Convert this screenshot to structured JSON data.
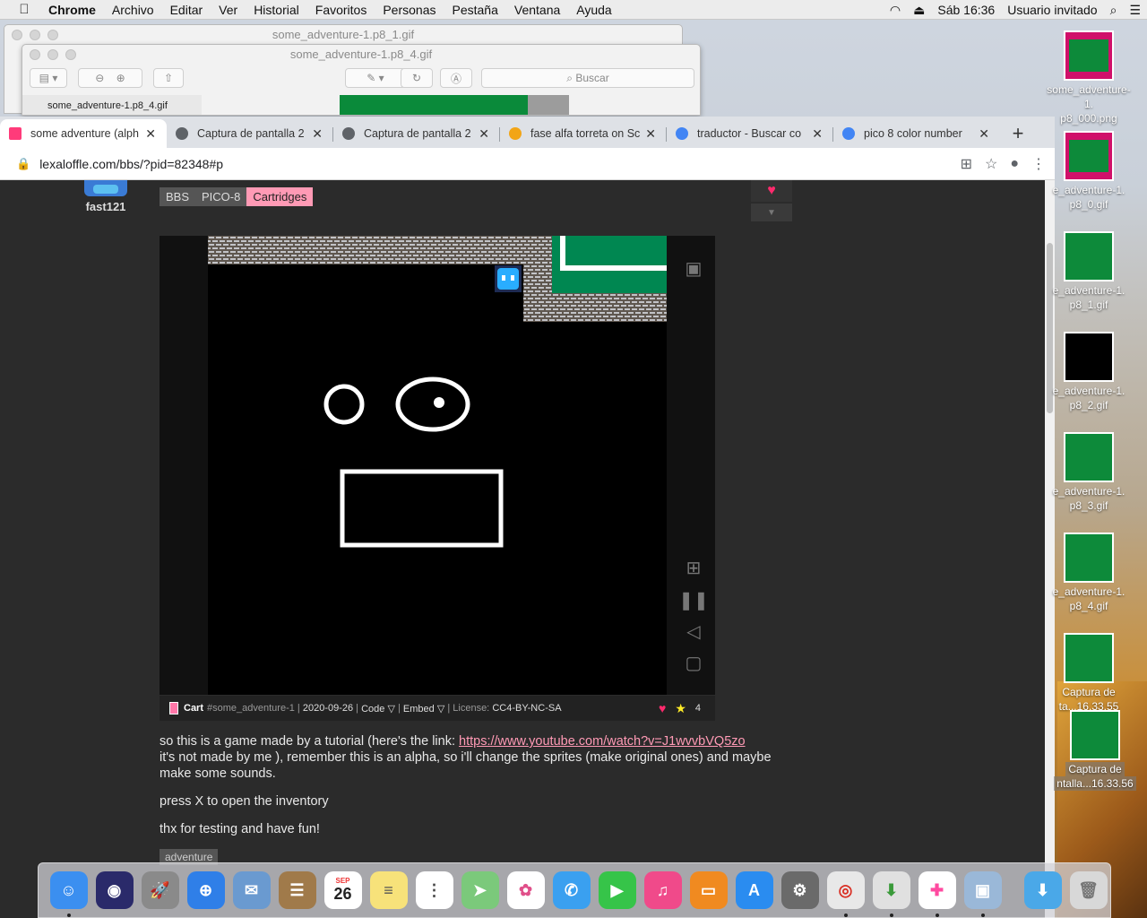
{
  "menubar": {
    "apple": "",
    "app_name": "Chrome",
    "items": [
      "Archivo",
      "Editar",
      "Ver",
      "Historial",
      "Favoritos",
      "Personas",
      "Pestaña",
      "Ventana",
      "Ayuda"
    ],
    "clock": "Sáb 16:36",
    "user": "Usuario invitado"
  },
  "preview_windows": {
    "back_title": "some_adventure-1.p8_1.gif",
    "front_title": "some_adventure-1.p8_4.gif",
    "search_placeholder": "Buscar",
    "sidebar_item": "some_adventure-1.p8_4.gif"
  },
  "tabs": [
    {
      "label": "some adventure (alph",
      "color": "#ff3b7a"
    },
    {
      "label": "Captura de pantalla 2",
      "color": "#5f6368"
    },
    {
      "label": "Captura de pantalla 2",
      "color": "#5f6368"
    },
    {
      "label": "fase alfa torreta on Sc",
      "color": "#f2a516"
    },
    {
      "label": "traductor - Buscar co",
      "color": "#4285f4"
    },
    {
      "label": "pico 8 color number",
      "color": "#4285f4"
    }
  ],
  "url": "lexaloffle.com/bbs/?pid=82348#p",
  "post": {
    "username": "fast121",
    "breadcrumbs": [
      "BBS",
      "PICO-8",
      "Cartridges"
    ],
    "cart_label": "Cart",
    "cart_id": "#some_adventure-1",
    "date": "2020-09-26",
    "code": "Code ▽",
    "embed": "Embed ▽",
    "license_label": "License:",
    "license": "CC4-BY-NC-SA",
    "stars": "4",
    "body_1a": "so this is a game made by a tutorial (here's the link: ",
    "link": "https://www.youtube.com/watch?v=J1wvvbVQ5zo",
    "body_1b": "it's not made by me ), remember this is an alpha, so i'll change the sprites (make original ones) and maybe make some sounds.",
    "body_2": "press X to open the inventory",
    "body_3": "thx for testing and have fun!",
    "tag": "adventure"
  },
  "desktop_icons": [
    {
      "line1": "some_adventure-1.",
      "line2": "p8_000.png"
    },
    {
      "line1": "e_adventure-1.",
      "line2": "p8_0.gif"
    },
    {
      "line1": "e_adventure-1.",
      "line2": "p8_1.gif"
    },
    {
      "line1": "e_adventure-1.",
      "line2": "p8_2.gif"
    },
    {
      "line1": "e_adventure-1.",
      "line2": "p8_3.gif"
    },
    {
      "line1": "e_adventure-1.",
      "line2": "p8_4.gif"
    },
    {
      "line1": "Captura de",
      "line2": "ta...16.33.55"
    },
    {
      "line1": "Captura de",
      "line2": "ntalla...16.33.56"
    }
  ],
  "dock_apps": [
    {
      "name": "finder",
      "color": "#3b8ff0",
      "glyph": "☺"
    },
    {
      "name": "siri",
      "color": "#2a2a6a",
      "glyph": "◉"
    },
    {
      "name": "launchpad",
      "color": "#8a8a8a",
      "glyph": "🚀"
    },
    {
      "name": "safari",
      "color": "#2f7fe8",
      "glyph": "⊕"
    },
    {
      "name": "mail",
      "color": "#6a9ad0",
      "glyph": "✉"
    },
    {
      "name": "contacts",
      "color": "#a07a4a",
      "glyph": "☰"
    },
    {
      "name": "calendar",
      "color": "#ffffff",
      "glyph": "26",
      "text": "#222",
      "cal_month": "SEP"
    },
    {
      "name": "notes",
      "color": "#f7e27a",
      "glyph": "≡",
      "text": "#555"
    },
    {
      "name": "reminders",
      "color": "#ffffff",
      "glyph": "⋮",
      "text": "#444"
    },
    {
      "name": "maps",
      "color": "#7bc97b",
      "glyph": "➤"
    },
    {
      "name": "photos",
      "color": "#ffffff",
      "glyph": "✿",
      "text": "#e0508a"
    },
    {
      "name": "messages",
      "color": "#3aa0f0",
      "glyph": "✆"
    },
    {
      "name": "facetime",
      "color": "#36c449",
      "glyph": "▶"
    },
    {
      "name": "itunes",
      "color": "#f04a8a",
      "glyph": "♫"
    },
    {
      "name": "ibooks",
      "color": "#f08a20",
      "glyph": "▭"
    },
    {
      "name": "app-store",
      "color": "#2a8cf0",
      "glyph": "A"
    },
    {
      "name": "system-preferences",
      "color": "#6a6a6a",
      "glyph": "⚙"
    },
    {
      "name": "chrome",
      "color": "#e8e8e8",
      "glyph": "◎",
      "text": "#d93025"
    },
    {
      "name": "installer",
      "color": "#e0e0e0",
      "glyph": "⬇",
      "text": "#3a9a3a"
    },
    {
      "name": "pico8",
      "color": "#ffffff",
      "glyph": "✚",
      "text": "#ff4aa0"
    },
    {
      "name": "preview",
      "color": "#9ab8d8",
      "glyph": "▣"
    },
    {
      "name": "downloads",
      "color": "#4aa8e8",
      "glyph": "⬇"
    },
    {
      "name": "trash",
      "color": "#d8d8d8",
      "glyph": "🗑",
      "text": "#777"
    }
  ]
}
